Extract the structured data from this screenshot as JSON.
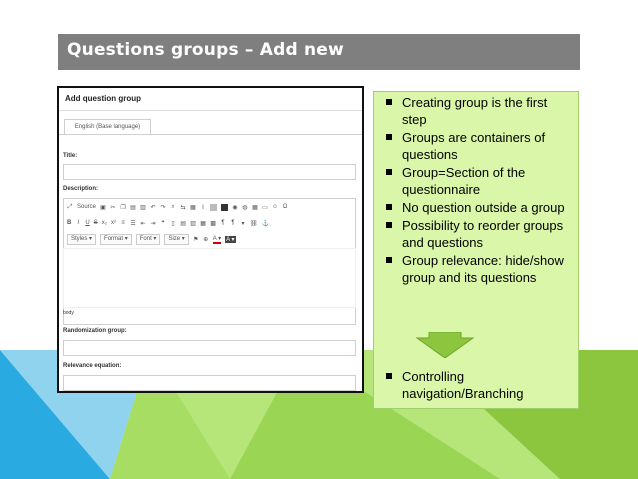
{
  "slide": {
    "title": "Questions groups – Add new"
  },
  "form": {
    "heading": "Add question group",
    "tab_label": "English (Base language)",
    "title_label": "Title:",
    "description_label": "Description:",
    "editor_row1": [
      "Source",
      "X",
      "B",
      "I"
    ],
    "editor_source_label": "Source",
    "editor_bold": "B",
    "editor_italic": "I",
    "editor_underline": "U",
    "editor_strike": "S",
    "editor_sub": "x₂",
    "editor_sup": "x²",
    "styles_label": "Styles",
    "format_label": "Format",
    "font_label": "Font",
    "size_label": "Size",
    "footer_tag": "body",
    "randomization_label": "Randomization group:",
    "relevance_label": "Relevance equation:"
  },
  "notes": {
    "bullets": [
      "Creating group is the first step",
      "Groups are containers of questions",
      "Group=Section of the questionnaire",
      "No question outside a group",
      "Possibility to reorder groups and questions",
      "Group relevance: hide/show group and its questions"
    ],
    "last_bullet": "Controlling navigation/Branching"
  },
  "colors": {
    "title_bar": "#7f7f7f",
    "notes_background": "#d9f6a9",
    "arrow": "#8cc63f",
    "decor_blue": "#29abe2",
    "decor_green": "#8cc63f"
  }
}
